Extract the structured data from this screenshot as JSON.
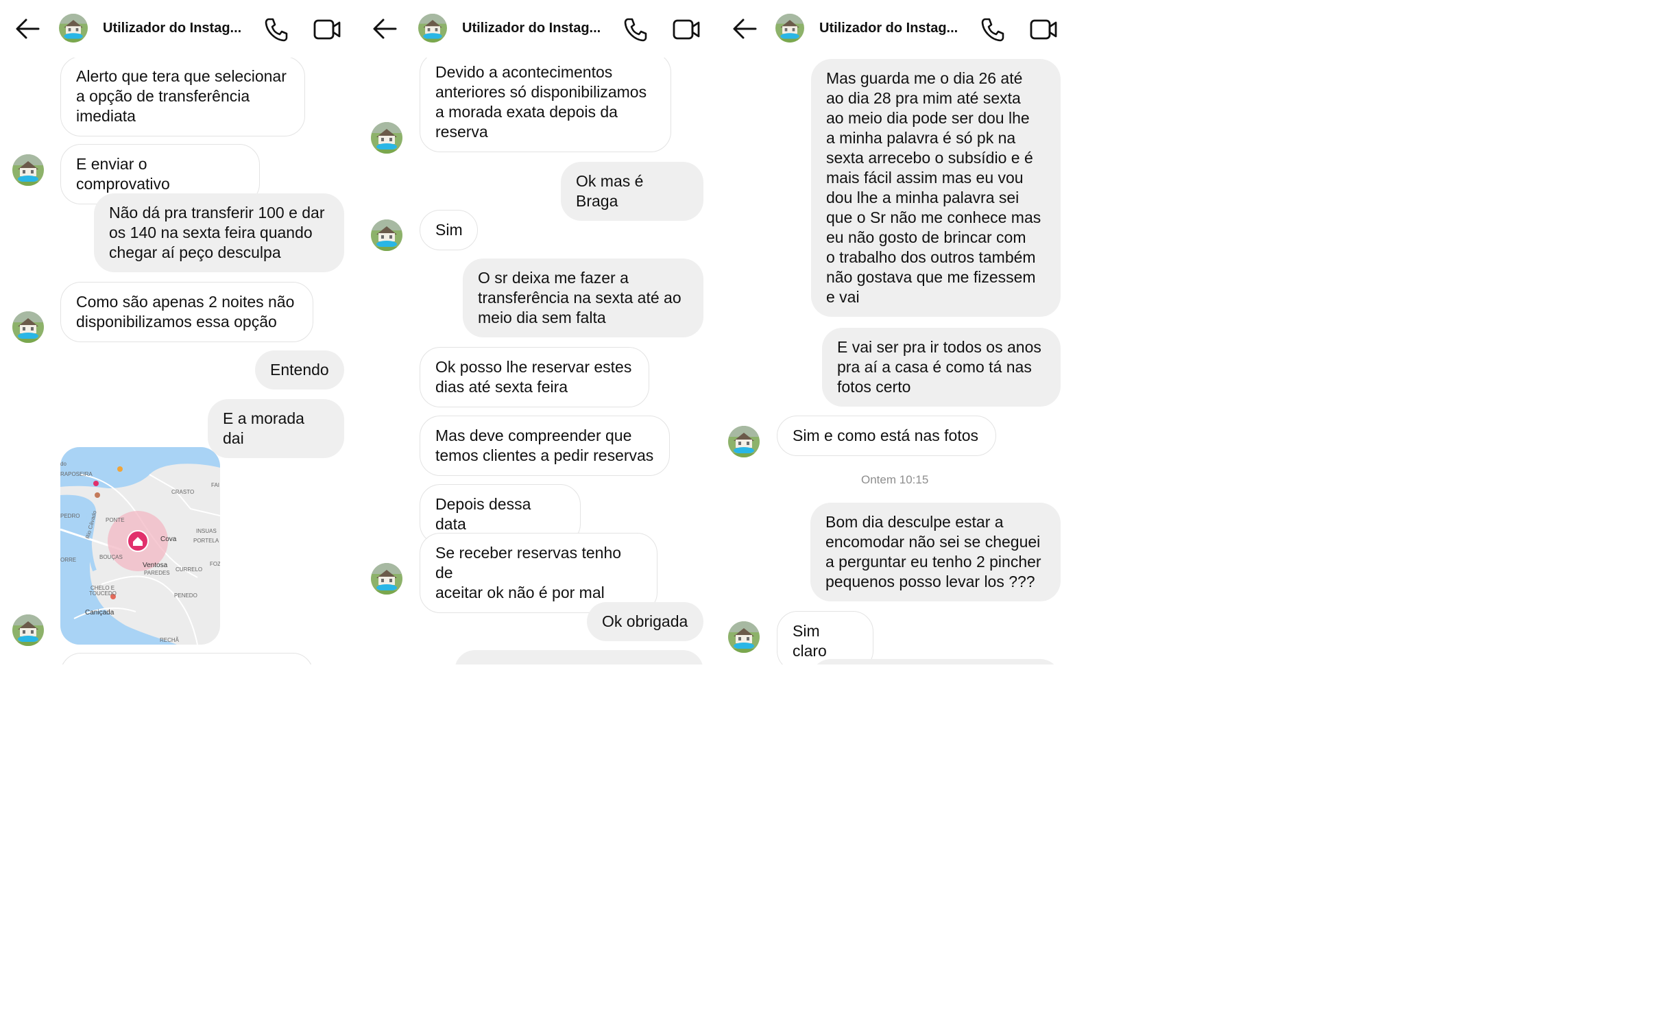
{
  "header": {
    "title": "Utilizador do Instag..."
  },
  "icons": {
    "back": "arrow-left-icon",
    "call": "phone-icon",
    "video": "video-camera-icon",
    "avatar": "house-pool-avatar",
    "pin": "home-pin-icon"
  },
  "colors": {
    "incoming_border": "#e3e3e3",
    "outgoing_bg": "#efefef",
    "pin": "#e1306c",
    "water": "#a9d3f5",
    "land": "#ececec",
    "timestamp": "#8e8e8e"
  },
  "panel1": {
    "m1": "Alerto que tera que selecionar\na opção de transferência\nimediata",
    "m2": "E enviar o comprovativo",
    "m3": "Não dá pra transferir 100 e dar\nos 140 na sexta feira quando\nchegar aí peço desculpa",
    "m4": "Como são apenas 2 noites não\ndisponibilizamos essa opção",
    "m5": "Entendo",
    "m6": "E a morada dai",
    "map_labels": {
      "do": "do",
      "raposeira": "RAPOSEIRA",
      "crasto": "CRASTO",
      "fai": "FAI",
      "pedro": "PEDRO",
      "ponte": "PONTE",
      "rio": "Rio Cávado",
      "insuas": "INSUAS",
      "portela": "PORTELA",
      "cova": "Cova",
      "orre": "ORRE",
      "boucas": "BOUÇAS",
      "ventosa": "Ventosa",
      "paredes": "PAREDES",
      "curvelo": "CURRELO",
      "foz": "FOZ",
      "chelo": "CHELO E",
      "toucedo": "TOUCEDO",
      "penedo": "PENEDO",
      "canicada": "Caniçada",
      "recha": "RECHÃ"
    }
  },
  "panel2": {
    "m1": "Devido a acontecimentos\nanteriores só disponibilizamos\na morada exata depois da\nreserva",
    "m2": "Ok mas é Braga",
    "m3": "Sim",
    "m4": "O sr deixa me fazer a\ntransferência na sexta até ao\nmeio dia sem falta",
    "m5": "Ok posso lhe reservar estes\ndias até sexta feira",
    "m6": "Mas deve compreender que\ntemos clientes a pedir reservas",
    "m7": "Depois dessa data",
    "m8": "Se receber reservas tenho de\naceitar ok não é por mal",
    "m9": "Ok obrigada"
  },
  "panel3": {
    "m1": "Mas guarda me o dia 26 até\nao dia 28 pra mim até sexta\nao meio dia pode ser dou lhe\na minha palavra é só pk na\nsexta arrecebo o subsídio e é\nmais fácil  assim mas eu vou\ndou lhe a minha palavra sei\nque o Sr não me conhece mas\neu não gosto de brincar com\no trabalho dos outros também\nnão gostava que me fizessem\ne vai",
    "m2": "E vai ser pra ir todos os anos\npra aí a casa é como tá nas\nfotos certo",
    "m3": "Sim e como está nas fotos",
    "timestamp": "Ontem 10:15",
    "m4": "Bom dia desculpe estar a\nencomodar não sei se cheguei\na perguntar eu tenho 2 pincher\npequenos posso levar los ???",
    "m5": "Sim claro"
  }
}
